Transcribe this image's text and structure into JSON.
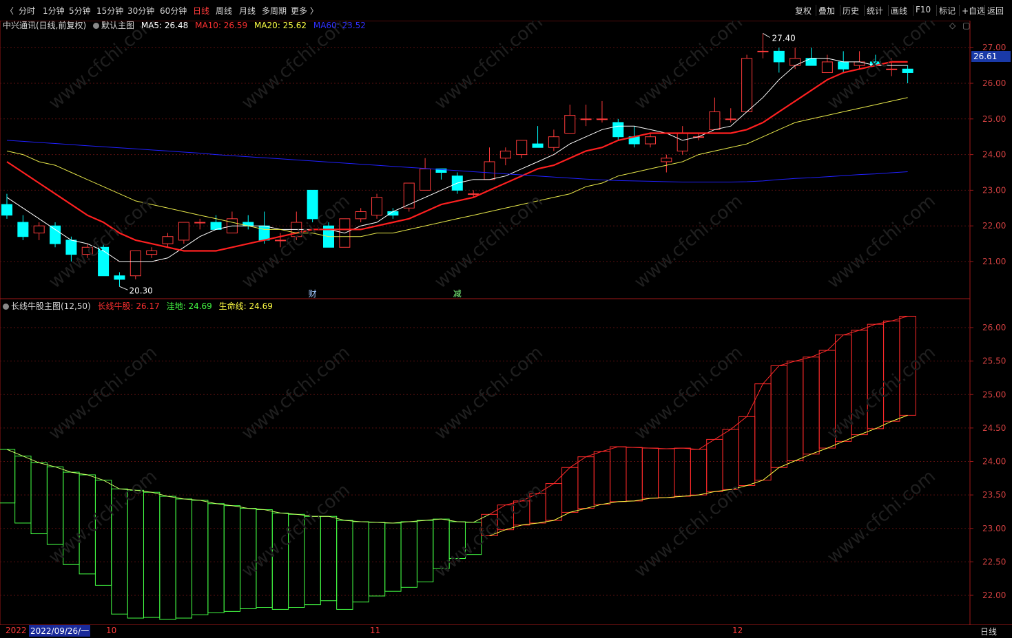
{
  "toolbar": {
    "periods": [
      "分时",
      "1分钟",
      "5分钟",
      "15分钟",
      "30分钟",
      "60分钟",
      "日线",
      "周线",
      "月线",
      "多周期",
      "更多 〉"
    ],
    "active_period": "日线",
    "right_tools": [
      "复权",
      "叠加",
      "历史",
      "统计",
      "画线",
      "F10",
      "标记",
      "+自选",
      "返回"
    ]
  },
  "main_legend": {
    "stock": "中兴通讯(日线,前复权)",
    "template": "默认主图",
    "ma5": "MA5: 26.48",
    "ma10": "MA10: 26.59",
    "ma20": "MA20: 25.62",
    "ma60": "MA60: 23.52"
  },
  "sub_legend": {
    "indicator": "长线牛股主图(12,50)",
    "bull": "长线牛股: 26.17",
    "depression": "洼地: 24.69",
    "lifeline": "生命线: 24.69"
  },
  "markers": {
    "high_label": "27.40",
    "low_label": "20.30",
    "event_cai": "财",
    "event_jian": "减"
  },
  "price_tag": "26.61",
  "bottom_bar": {
    "year": "2022",
    "date": "2022/09/26/一",
    "month_10": "10",
    "month_11": "11",
    "month_12": "12",
    "period_label": "日线"
  },
  "colors": {
    "up": "#ff3b3b",
    "down": "#00ffff",
    "ma5": "#ffffff",
    "ma10": "#ff2020",
    "ma20": "#e8e84a",
    "ma60": "#2020ff",
    "bull": "#ff2a2a",
    "green": "#44ff44",
    "yellow": "#ffff44"
  },
  "chart_data": [
    {
      "type": "candlestick",
      "title": "中兴通讯(日线,前复权)",
      "y_ticks": [
        21.0,
        22.0,
        23.0,
        24.0,
        25.0,
        26.0,
        27.0
      ],
      "ylim": [
        20.0,
        27.9
      ],
      "candles": [
        {
          "o": 22.6,
          "h": 22.9,
          "l": 22.2,
          "c": 22.3
        },
        {
          "o": 22.1,
          "h": 22.3,
          "l": 21.6,
          "c": 21.7
        },
        {
          "o": 21.8,
          "h": 22.1,
          "l": 21.6,
          "c": 22.0
        },
        {
          "o": 22.0,
          "h": 22.1,
          "l": 21.4,
          "c": 21.5
        },
        {
          "o": 21.6,
          "h": 21.7,
          "l": 21.0,
          "c": 21.2
        },
        {
          "o": 21.2,
          "h": 21.5,
          "l": 21.1,
          "c": 21.4
        },
        {
          "o": 21.4,
          "h": 21.5,
          "l": 20.6,
          "c": 20.6
        },
        {
          "o": 20.6,
          "h": 20.7,
          "l": 20.3,
          "c": 20.5
        },
        {
          "o": 20.6,
          "h": 21.3,
          "l": 20.5,
          "c": 21.3
        },
        {
          "o": 21.2,
          "h": 21.4,
          "l": 21.1,
          "c": 21.3
        },
        {
          "o": 21.5,
          "h": 21.8,
          "l": 21.4,
          "c": 21.7
        },
        {
          "o": 21.6,
          "h": 22.1,
          "l": 21.5,
          "c": 22.1
        },
        {
          "o": 22.1,
          "h": 22.2,
          "l": 21.9,
          "c": 22.1
        },
        {
          "o": 22.1,
          "h": 22.3,
          "l": 21.9,
          "c": 21.9
        },
        {
          "o": 21.8,
          "h": 22.4,
          "l": 21.8,
          "c": 22.2
        },
        {
          "o": 22.1,
          "h": 22.3,
          "l": 21.9,
          "c": 22.0
        },
        {
          "o": 22.0,
          "h": 22.4,
          "l": 21.5,
          "c": 21.6
        },
        {
          "o": 21.6,
          "h": 21.8,
          "l": 21.4,
          "c": 21.6
        },
        {
          "o": 21.7,
          "h": 22.4,
          "l": 21.6,
          "c": 22.1
        },
        {
          "o": 23.0,
          "h": 23.0,
          "l": 22.1,
          "c": 22.2
        },
        {
          "o": 22.0,
          "h": 22.1,
          "l": 21.4,
          "c": 21.4
        },
        {
          "o": 21.4,
          "h": 22.2,
          "l": 21.4,
          "c": 22.2
        },
        {
          "o": 22.2,
          "h": 22.5,
          "l": 22.1,
          "c": 22.4
        },
        {
          "o": 22.3,
          "h": 22.9,
          "l": 22.2,
          "c": 22.8
        },
        {
          "o": 22.4,
          "h": 22.5,
          "l": 22.2,
          "c": 22.3
        },
        {
          "o": 22.5,
          "h": 23.2,
          "l": 22.4,
          "c": 23.2
        },
        {
          "o": 23.0,
          "h": 23.9,
          "l": 23.0,
          "c": 23.6
        },
        {
          "o": 23.6,
          "h": 23.6,
          "l": 23.3,
          "c": 23.5
        },
        {
          "o": 23.4,
          "h": 23.5,
          "l": 22.9,
          "c": 23.0
        },
        {
          "o": 22.9,
          "h": 23.0,
          "l": 22.8,
          "c": 22.9
        },
        {
          "o": 23.3,
          "h": 24.2,
          "l": 23.3,
          "c": 23.8
        },
        {
          "o": 23.9,
          "h": 24.2,
          "l": 23.7,
          "c": 24.1
        },
        {
          "o": 24.0,
          "h": 24.4,
          "l": 23.9,
          "c": 24.4
        },
        {
          "o": 24.3,
          "h": 24.8,
          "l": 24.2,
          "c": 24.2
        },
        {
          "o": 24.2,
          "h": 24.7,
          "l": 24.1,
          "c": 24.5
        },
        {
          "o": 24.6,
          "h": 25.4,
          "l": 24.6,
          "c": 25.1
        },
        {
          "o": 25.0,
          "h": 25.4,
          "l": 24.8,
          "c": 25.0
        },
        {
          "o": 25.0,
          "h": 25.5,
          "l": 24.9,
          "c": 25.0
        },
        {
          "o": 24.9,
          "h": 25.0,
          "l": 24.4,
          "c": 24.5
        },
        {
          "o": 24.5,
          "h": 24.8,
          "l": 24.2,
          "c": 24.3
        },
        {
          "o": 24.3,
          "h": 24.6,
          "l": 24.2,
          "c": 24.5
        },
        {
          "o": 23.8,
          "h": 24.0,
          "l": 23.5,
          "c": 23.9
        },
        {
          "o": 24.1,
          "h": 24.8,
          "l": 24.0,
          "c": 24.6
        },
        {
          "o": 24.5,
          "h": 24.6,
          "l": 24.4,
          "c": 24.5
        },
        {
          "o": 24.7,
          "h": 25.6,
          "l": 24.7,
          "c": 25.2
        },
        {
          "o": 25.0,
          "h": 25.3,
          "l": 24.9,
          "c": 25.0
        },
        {
          "o": 25.2,
          "h": 26.8,
          "l": 25.2,
          "c": 26.7
        },
        {
          "o": 26.9,
          "h": 27.4,
          "l": 26.7,
          "c": 26.9
        },
        {
          "o": 26.9,
          "h": 27.0,
          "l": 26.3,
          "c": 26.6
        },
        {
          "o": 26.5,
          "h": 27.0,
          "l": 26.4,
          "c": 26.7
        },
        {
          "o": 26.7,
          "h": 27.0,
          "l": 26.5,
          "c": 26.5
        },
        {
          "o": 26.3,
          "h": 26.8,
          "l": 26.3,
          "c": 26.6
        },
        {
          "o": 26.6,
          "h": 26.9,
          "l": 26.3,
          "c": 26.4
        },
        {
          "o": 26.5,
          "h": 26.9,
          "l": 26.4,
          "c": 26.6
        },
        {
          "o": 26.6,
          "h": 26.8,
          "l": 26.5,
          "c": 26.5
        },
        {
          "o": 26.4,
          "h": 26.7,
          "l": 26.2,
          "c": 26.4
        },
        {
          "o": 26.4,
          "h": 26.5,
          "l": 26.0,
          "c": 26.3
        }
      ],
      "series": [
        {
          "name": "MA5",
          "values": [
            22.8,
            22.5,
            22.2,
            21.9,
            21.6,
            21.5,
            21.3,
            21.0,
            21.0,
            21.0,
            21.1,
            21.4,
            21.7,
            21.9,
            22.0,
            22.0,
            22.0,
            21.9,
            21.9,
            21.9,
            21.9,
            21.8,
            22.0,
            22.1,
            22.4,
            22.6,
            22.8,
            23.0,
            23.2,
            23.3,
            23.3,
            23.4,
            23.6,
            23.8,
            24.0,
            24.3,
            24.5,
            24.7,
            24.8,
            24.8,
            24.7,
            24.6,
            24.4,
            24.5,
            24.7,
            24.8,
            25.2,
            25.6,
            26.1,
            26.5,
            26.7,
            26.7,
            26.6,
            26.6,
            26.5,
            26.5,
            26.5
          ]
        },
        {
          "name": "MA10",
          "values": [
            23.8,
            23.5,
            23.2,
            22.9,
            22.6,
            22.3,
            22.1,
            21.8,
            21.6,
            21.5,
            21.4,
            21.3,
            21.3,
            21.3,
            21.4,
            21.5,
            21.6,
            21.7,
            21.8,
            21.9,
            21.9,
            21.9,
            21.9,
            22.0,
            22.1,
            22.2,
            22.4,
            22.6,
            22.7,
            22.8,
            23.0,
            23.2,
            23.4,
            23.6,
            23.7,
            23.9,
            24.1,
            24.2,
            24.4,
            24.5,
            24.6,
            24.6,
            24.6,
            24.6,
            24.6,
            24.6,
            24.7,
            24.9,
            25.2,
            25.5,
            25.8,
            26.1,
            26.3,
            26.4,
            26.5,
            26.6,
            26.6
          ]
        },
        {
          "name": "MA20",
          "values": [
            24.1,
            24.0,
            23.8,
            23.7,
            23.5,
            23.3,
            23.1,
            22.9,
            22.7,
            22.6,
            22.5,
            22.4,
            22.3,
            22.2,
            22.1,
            22.0,
            21.9,
            21.9,
            21.8,
            21.8,
            21.7,
            21.7,
            21.7,
            21.8,
            21.8,
            21.9,
            22.0,
            22.1,
            22.2,
            22.3,
            22.4,
            22.5,
            22.6,
            22.7,
            22.8,
            22.9,
            23.1,
            23.2,
            23.4,
            23.5,
            23.6,
            23.7,
            23.8,
            24.0,
            24.1,
            24.2,
            24.3,
            24.5,
            24.7,
            24.9,
            25.0,
            25.1,
            25.2,
            25.3,
            25.4,
            25.5,
            25.6
          ]
        },
        {
          "name": "MA60",
          "values": [
            24.4,
            24.37,
            24.34,
            24.31,
            24.28,
            24.25,
            24.22,
            24.19,
            24.16,
            24.13,
            24.1,
            24.07,
            24.04,
            24.0,
            23.97,
            23.94,
            23.91,
            23.88,
            23.85,
            23.82,
            23.79,
            23.76,
            23.73,
            23.7,
            23.67,
            23.64,
            23.61,
            23.58,
            23.55,
            23.52,
            23.49,
            23.46,
            23.43,
            23.4,
            23.37,
            23.34,
            23.31,
            23.29,
            23.27,
            23.26,
            23.25,
            23.24,
            23.23,
            23.23,
            23.23,
            23.23,
            23.24,
            23.26,
            23.3,
            23.33,
            23.35,
            23.38,
            23.41,
            23.44,
            23.46,
            23.49,
            23.52
          ]
        }
      ]
    },
    {
      "type": "area",
      "title": "长线牛股主图(12,50)",
      "y_ticks": [
        22.0,
        22.5,
        23.0,
        23.5,
        24.0,
        24.5,
        25.0,
        25.5,
        26.0
      ],
      "ylim": [
        21.55,
        26.4
      ],
      "series": [
        {
          "name": "长线牛股",
          "values": [
            24.18,
            24.08,
            23.98,
            23.92,
            23.84,
            23.8,
            23.72,
            23.59,
            23.57,
            23.54,
            23.48,
            23.44,
            23.42,
            23.37,
            23.34,
            23.3,
            23.28,
            23.23,
            23.21,
            23.18,
            23.18,
            23.12,
            23.1,
            23.09,
            23.08,
            23.1,
            23.12,
            23.14,
            23.1,
            23.09,
            23.21,
            23.35,
            23.41,
            23.52,
            23.67,
            23.91,
            24.07,
            24.15,
            24.22,
            24.21,
            24.2,
            24.19,
            24.2,
            24.18,
            24.33,
            24.48,
            24.67,
            25.16,
            25.43,
            25.5,
            25.56,
            25.66,
            25.89,
            25.96,
            26.05,
            26.1,
            26.17
          ]
        },
        {
          "name": "洼地",
          "values": [
            23.38,
            23.08,
            22.92,
            22.76,
            22.46,
            22.32,
            22.15,
            21.72,
            21.66,
            21.67,
            21.64,
            21.66,
            21.71,
            21.74,
            21.76,
            21.8,
            21.82,
            21.79,
            21.82,
            21.86,
            21.92,
            21.79,
            21.9,
            21.99,
            22.06,
            22.12,
            22.2,
            22.4,
            22.55,
            22.61,
            22.89,
            22.98,
            23.05,
            23.08,
            23.12,
            23.24,
            23.3,
            23.36,
            23.4,
            23.41,
            23.45,
            23.46,
            23.48,
            23.5,
            23.55,
            23.58,
            23.64,
            23.72,
            23.91,
            24.01,
            24.11,
            24.2,
            24.3,
            24.4,
            24.49,
            24.6,
            24.69
          ]
        },
        {
          "name": "生命线",
          "values": [
            24.18,
            24.08,
            23.98,
            23.92,
            23.84,
            23.8,
            23.72,
            23.59,
            23.57,
            23.54,
            23.48,
            23.44,
            23.42,
            23.37,
            23.34,
            23.3,
            23.28,
            23.23,
            23.21,
            23.18,
            23.18,
            23.12,
            23.1,
            23.09,
            23.08,
            23.1,
            23.12,
            23.14,
            23.1,
            23.09,
            22.89,
            22.98,
            23.05,
            23.08,
            23.12,
            23.24,
            23.3,
            23.36,
            23.4,
            23.41,
            23.45,
            23.46,
            23.48,
            23.5,
            23.55,
            23.58,
            23.64,
            23.72,
            23.91,
            24.01,
            24.11,
            24.2,
            24.3,
            24.4,
            24.49,
            24.6,
            24.69
          ]
        }
      ]
    }
  ]
}
